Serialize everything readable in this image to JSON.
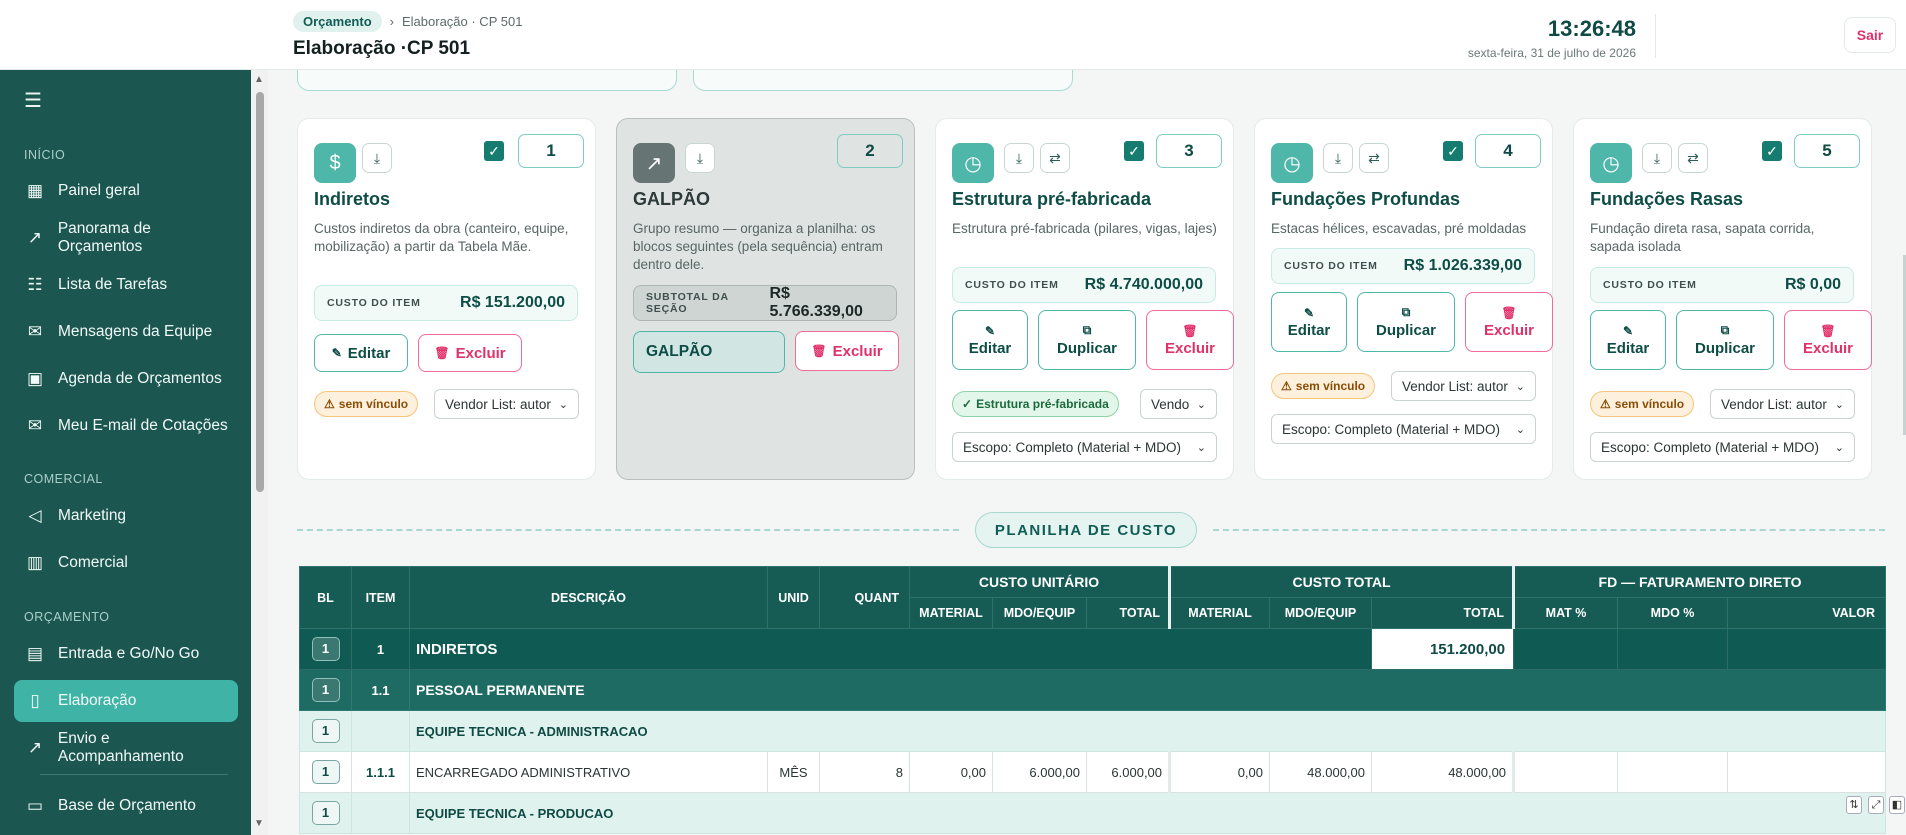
{
  "header": {
    "crumb_home": "Orçamento",
    "crumb_sep": "›",
    "crumb_current": "Elaboração · CP 501",
    "page_title": "Elaboração ·CP 501",
    "time": "13:26:48",
    "date": "sexta-feira, 31 de julho de 2026",
    "logout": "Sair"
  },
  "sidebar": {
    "section_inicio": "INÍCIO",
    "section_comercial": "COMERCIAL",
    "section_orcamento": "ORÇAMENTO",
    "items": [
      {
        "label": "Painel geral",
        "icon": "grid-icon"
      },
      {
        "label": "Panorama de Orçamentos",
        "icon": "trend-icon"
      },
      {
        "label": "Lista de Tarefas",
        "icon": "list-icon"
      },
      {
        "label": "Mensagens da Equipe",
        "icon": "mail-icon"
      },
      {
        "label": "Agenda de Orçamentos",
        "icon": "calendar-icon"
      },
      {
        "label": "Meu E-mail de Cotações",
        "icon": "mail-icon"
      },
      {
        "label": "Marketing",
        "icon": "megaphone-icon"
      },
      {
        "label": "Comercial",
        "icon": "building-icon"
      },
      {
        "label": "Entrada e Go/No Go",
        "icon": "doc-icon"
      },
      {
        "label": "Elaboração",
        "icon": "clipboard-icon"
      },
      {
        "label": "Envio e Acompanhamento",
        "icon": "trend-icon"
      },
      {
        "label": "Base de Orçamento",
        "icon": "database-icon"
      }
    ]
  },
  "cards": [
    {
      "num": "1",
      "title": "Indiretos",
      "desc": "Custos indiretos da obra (canteiro, equipe, mobilização) a partir da Tabela Mãe.",
      "cost_label": "CUSTO DO ITEM",
      "cost": "R$ 151.200,00",
      "edit": "Editar",
      "delete": "Excluir",
      "tag": "sem vínculo",
      "vendor": "Vendor List: autor"
    },
    {
      "num": "2",
      "title": "GALPÃO",
      "desc": "Grupo resumo — organiza a planilha: os blocos seguintes (pela sequência) entram dentro dele.",
      "cost_label": "SUBTOTAL DA SEÇÃO",
      "cost": "R$ 5.766.339,00",
      "group_name": "GALPÃO",
      "delete": "Excluir"
    },
    {
      "num": "3",
      "title": "Estrutura pré-fabricada",
      "desc": "Estrutura pré-fabricada (pilares, vigas, lajes)",
      "cost_label": "CUSTO DO ITEM",
      "cost": "R$ 4.740.000,00",
      "edit": "Editar",
      "duplicate": "Duplicar",
      "delete": "Excluir",
      "tag": "Estrutura pré-fabricada",
      "vendor": "Vendo",
      "scope": "Escopo: Completo (Material + MDO)"
    },
    {
      "num": "4",
      "title": "Fundações Profundas",
      "desc": "Estacas hélices, escavadas, pré moldadas",
      "cost_label": "CUSTO DO ITEM",
      "cost": "R$ 1.026.339,00",
      "edit": "Editar",
      "duplicate": "Duplicar",
      "delete": "Excluir",
      "tag": "sem vínculo",
      "vendor": "Vendor List: autor",
      "scope": "Escopo: Completo (Material + MDO)"
    },
    {
      "num": "5",
      "title": "Fundações Rasas",
      "desc": "Fundação direta rasa, sapata corrida, sapada isolada",
      "cost_label": "CUSTO DO ITEM",
      "cost": "R$ 0,00",
      "edit": "Editar",
      "duplicate": "Duplicar",
      "delete": "Excluir",
      "tag": "sem vínculo",
      "vendor": "Vendor List: autor",
      "scope": "Escopo: Completo (Material + MDO)"
    }
  ],
  "planilha_label": "PLANILHA DE CUSTO",
  "table": {
    "h_bl": "BL",
    "h_item": "ITEM",
    "h_desc": "DESCRIÇÃO",
    "h_unid": "UNID",
    "h_quant": "QUANT",
    "g_unit": "CUSTO UNITÁRIO",
    "g_total": "CUSTO TOTAL",
    "g_fd": "FD — FATURAMENTO DIRETO",
    "s_material": "MATERIAL",
    "s_mdo": "MDO/EQUIP",
    "s_total": "TOTAL",
    "s_mat_pct": "MAT %",
    "s_mdo_pct": "MDO %",
    "s_valor": "VALOR",
    "rows": [
      {
        "bl": "1",
        "item": "1",
        "desc": "INDIRETOS",
        "total": "151.200,00"
      },
      {
        "bl": "1",
        "item": "1.1",
        "desc": "PESSOAL PERMANENTE"
      },
      {
        "bl": "1",
        "item": "",
        "desc": "EQUIPE TECNICA - ADMINISTRACAO"
      },
      {
        "bl": "1",
        "item": "1.1.1",
        "desc": "ENCARREGADO ADMINISTRATIVO",
        "unid": "MÊS",
        "quant": "8",
        "u_mat": "0,00",
        "u_mdo": "6.000,00",
        "u_total": "6.000,00",
        "t_mat": "0,00",
        "t_mdo": "48.000,00",
        "t_total": "48.000,00"
      },
      {
        "bl": "1",
        "item": "",
        "desc": "EQUIPE TECNICA - PRODUCAO"
      }
    ]
  }
}
